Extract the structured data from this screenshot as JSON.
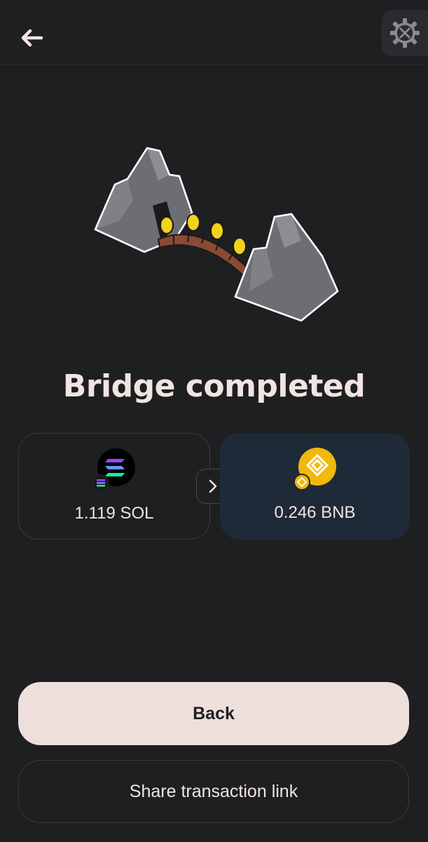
{
  "header": {
    "back_icon": "back-arrow-icon",
    "settings_icon": "gear-tools-icon"
  },
  "illustration": "bridge-illustration",
  "title": "Bridge completed",
  "from": {
    "amount": "1.119 SOL",
    "icon": "solana-icon"
  },
  "to": {
    "amount": "0.246 BNB",
    "icon": "bnb-icon"
  },
  "swap_icon": "chevron-right-icon",
  "buttons": {
    "back": "Back",
    "share": "Share transaction link"
  },
  "colors": {
    "background": "#1e1f21",
    "primary_button": "#eedfdd",
    "to_card": "#1f2a38",
    "bnb_yellow": "#f0b90b"
  }
}
